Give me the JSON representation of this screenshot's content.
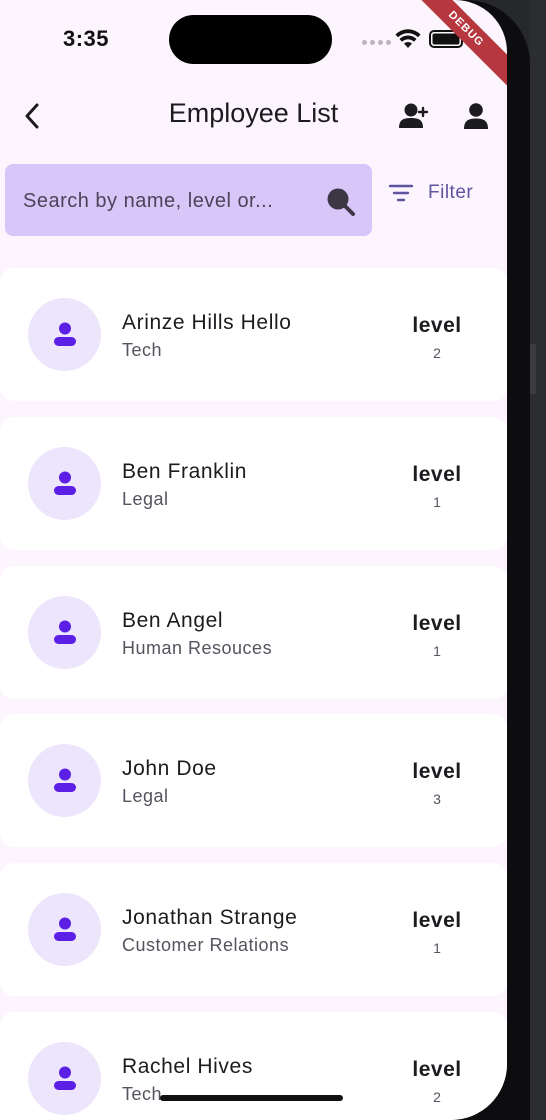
{
  "status_bar": {
    "time": "3:35",
    "debug_banner": "DEBUG"
  },
  "app_bar": {
    "title": "Employee List",
    "icons": {
      "back": "chevron-left-icon",
      "add_user": "person-add-icon",
      "profile": "person-icon"
    }
  },
  "search": {
    "placeholder": "Search by name, level or...",
    "value": ""
  },
  "filter": {
    "label": "Filter"
  },
  "employees": [
    {
      "name": "Arinze Hills Hello",
      "department": "Tech",
      "level_label": "level",
      "level": "2"
    },
    {
      "name": "Ben Franklin",
      "department": "Legal",
      "level_label": "level",
      "level": "1"
    },
    {
      "name": "Ben Angel",
      "department": "Human Resouces",
      "level_label": "level",
      "level": "1"
    },
    {
      "name": "John Doe",
      "department": "Legal",
      "level_label": "level",
      "level": "3"
    },
    {
      "name": "Jonathan Strange",
      "department": "Customer Relations",
      "level_label": "level",
      "level": "1"
    },
    {
      "name": "Rachel Hives",
      "department": "Tech",
      "level_label": "level",
      "level": "2"
    }
  ],
  "colors": {
    "accent": "#5b1fe6",
    "search_bg": "#d8c6f9",
    "avatar_bg": "#ece5fc",
    "page_bg": "#fcf5fd",
    "debug": "#b7373f"
  }
}
